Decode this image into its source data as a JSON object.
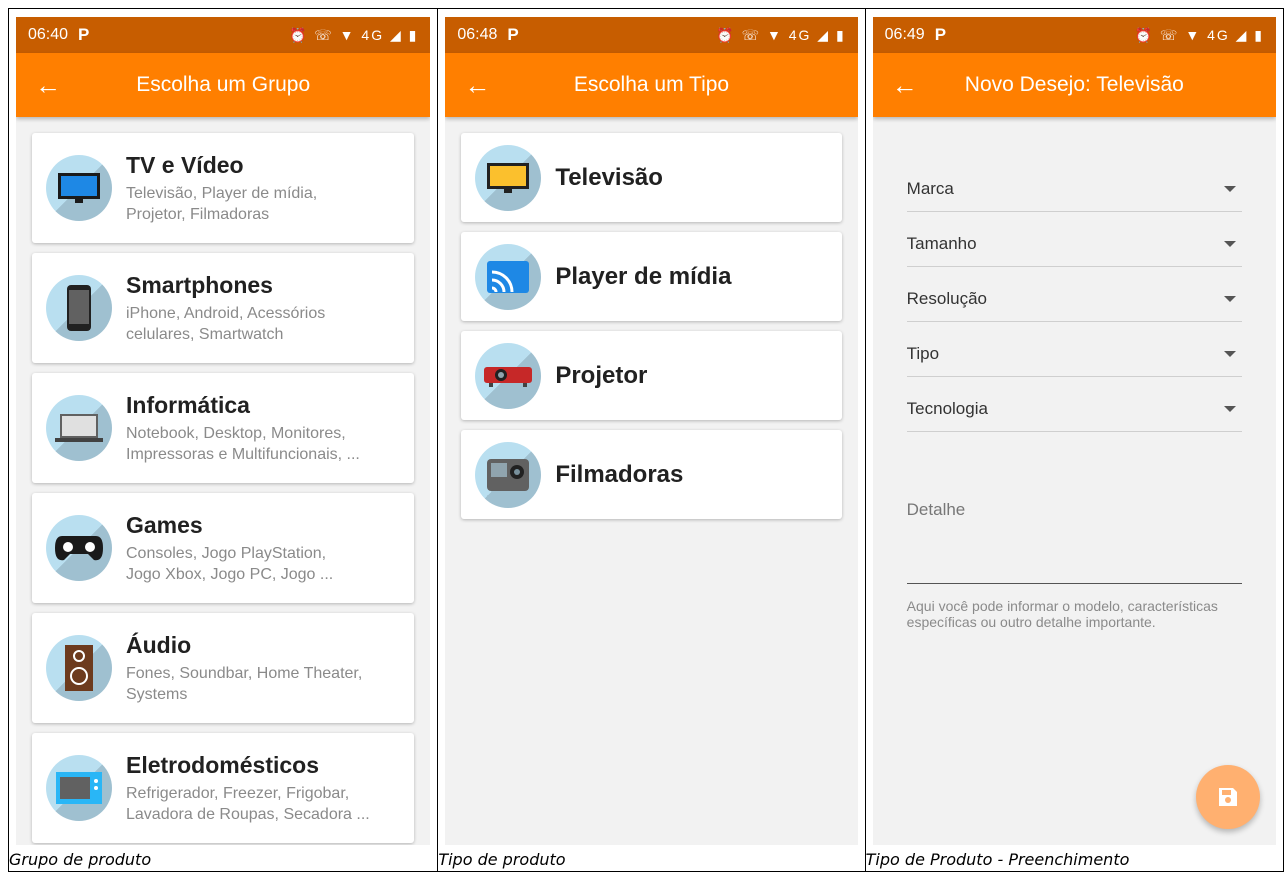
{
  "panels": [
    {
      "status": {
        "time": "06:40",
        "p": "P",
        "icons": "⏰ ☏ ▼ 4G ◢ ▮"
      },
      "appbar": {
        "back_icon": "arrow-left-icon",
        "title": "Escolha um Grupo"
      },
      "groups": [
        {
          "title": "TV e Vídeo",
          "sub1": "Televisão, Player de mídia,",
          "sub2": "Projetor, Filmadoras",
          "icon": "tv-icon"
        },
        {
          "title": "Smartphones",
          "sub1": "iPhone, Android, Acessórios",
          "sub2": "celulares, Smartwatch",
          "icon": "smartphone-icon"
        },
        {
          "title": "Informática",
          "sub1": "Notebook, Desktop, Monitores,",
          "sub2": "Impressoras e Multifuncionais, ...",
          "icon": "laptop-icon"
        },
        {
          "title": "Games",
          "sub1": "Consoles, Jogo PlayStation,",
          "sub2": "Jogo Xbox, Jogo PC, Jogo ...",
          "icon": "gamepad-icon"
        },
        {
          "title": "Áudio",
          "sub1": "Fones, Soundbar, Home Theater,",
          "sub2": "Systems",
          "icon": "speaker-icon"
        },
        {
          "title": "Eletrodomésticos",
          "sub1": "Refrigerador, Freezer, Frigobar,",
          "sub2": "Lavadora de Roupas, Secadora ...",
          "icon": "microwave-icon"
        }
      ],
      "caption": "Grupo de produto"
    },
    {
      "status": {
        "time": "06:48",
        "p": "P",
        "icons": "⏰ ☏ ▼ 4G ◢ ▮"
      },
      "appbar": {
        "back_icon": "arrow-left-icon",
        "title": "Escolha um Tipo"
      },
      "types": [
        {
          "title": "Televisão",
          "icon": "television-icon"
        },
        {
          "title": "Player de mídia",
          "icon": "cast-icon"
        },
        {
          "title": "Projetor",
          "icon": "projector-icon"
        },
        {
          "title": "Filmadoras",
          "icon": "camcorder-icon"
        }
      ],
      "caption": "Tipo de produto"
    },
    {
      "status": {
        "time": "06:49",
        "p": "P",
        "icons": "⏰ ☏ ▼ 4G ◢ ▮"
      },
      "appbar": {
        "back_icon": "arrow-left-icon",
        "title": "Novo Desejo: Televisão"
      },
      "fields": [
        "Marca",
        "Tamanho",
        "Resolução",
        "Tipo",
        "Tecnologia"
      ],
      "detail_label": "Detalhe",
      "helper": "Aqui você pode informar o modelo, características específicas ou outro detalhe importante.",
      "fab_icon": "save-icon",
      "caption": "Tipo de Produto - Preenchimento"
    }
  ],
  "colors": {
    "appbar": "#ff7f00",
    "statusbar": "#c75d00",
    "fab": "#ffb070"
  }
}
